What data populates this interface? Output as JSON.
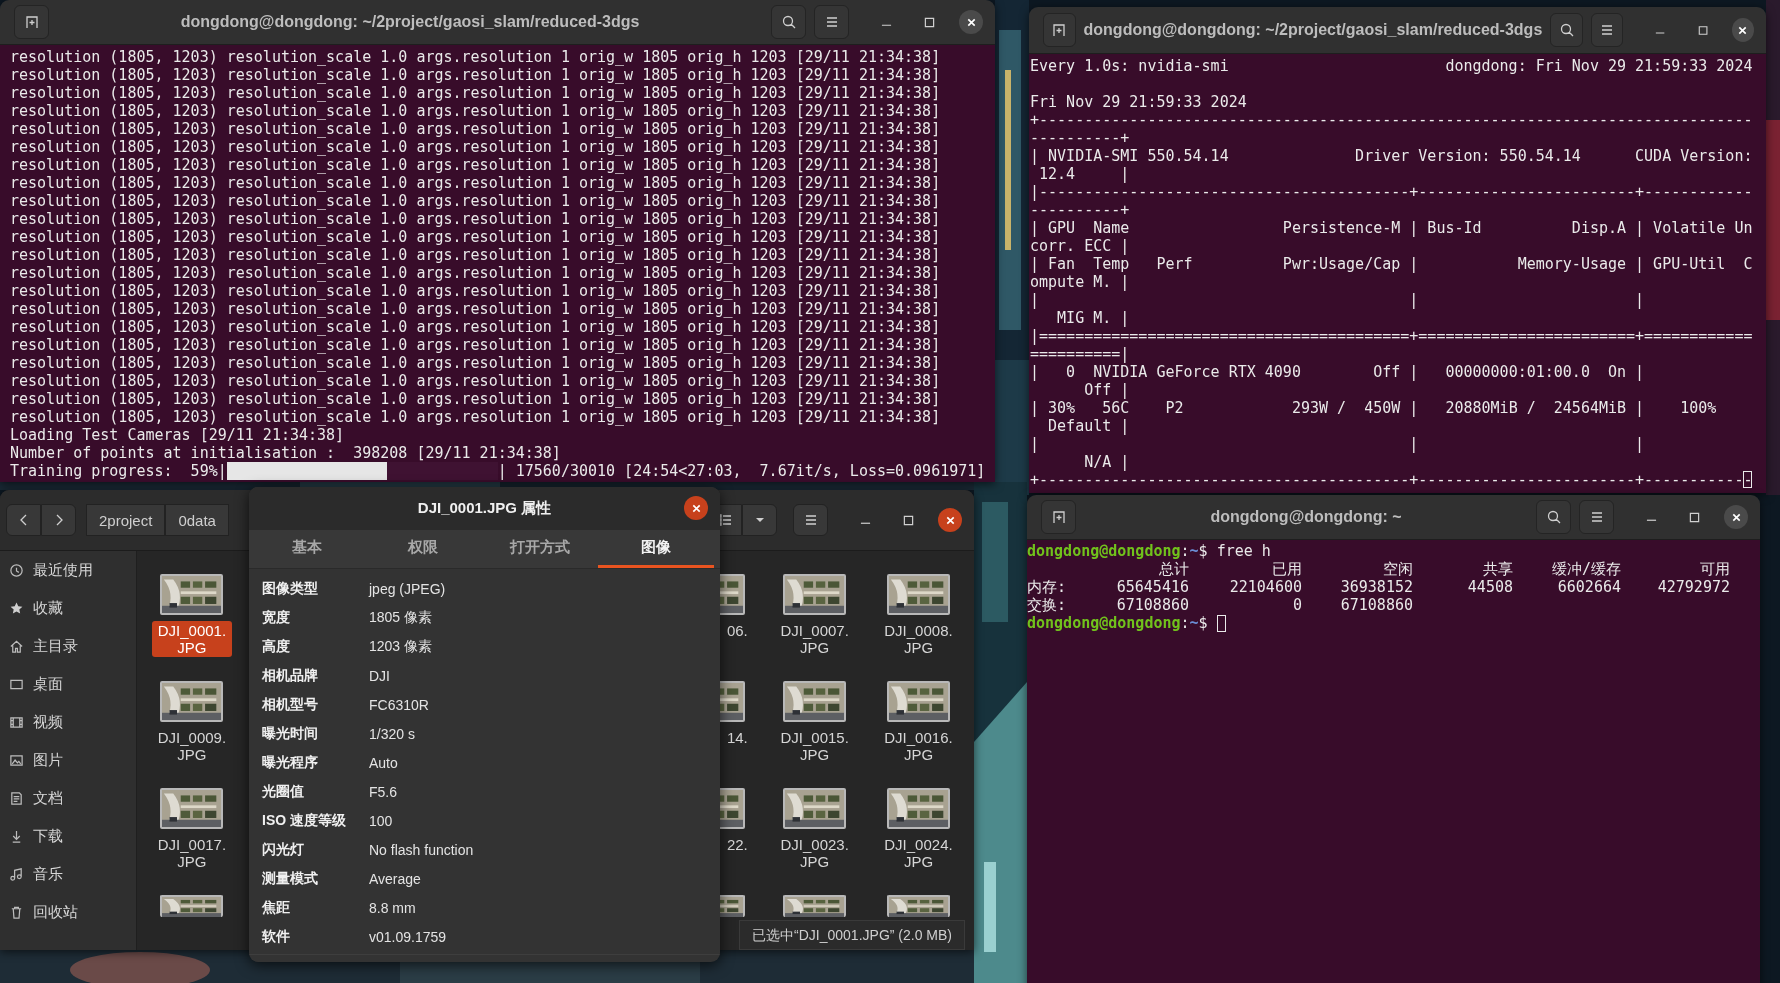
{
  "terminal_training": {
    "title": "dongdong@dongdong: ~/2project/gaosi_slam/reduced-3dgs",
    "lines": [
      "resolution (1805, 1203) resolution_scale 1.0 args.resolution 1 orig_w 1805 orig_h 1203 [29/11 21:34:38]",
      "resolution (1805, 1203) resolution_scale 1.0 args.resolution 1 orig_w 1805 orig_h 1203 [29/11 21:34:38]",
      "resolution (1805, 1203) resolution_scale 1.0 args.resolution 1 orig_w 1805 orig_h 1203 [29/11 21:34:38]",
      "resolution (1805, 1203) resolution_scale 1.0 args.resolution 1 orig_w 1805 orig_h 1203 [29/11 21:34:38]",
      "resolution (1805, 1203) resolution_scale 1.0 args.resolution 1 orig_w 1805 orig_h 1203 [29/11 21:34:38]",
      "resolution (1805, 1203) resolution_scale 1.0 args.resolution 1 orig_w 1805 orig_h 1203 [29/11 21:34:38]",
      "resolution (1805, 1203) resolution_scale 1.0 args.resolution 1 orig_w 1805 orig_h 1203 [29/11 21:34:38]",
      "resolution (1805, 1203) resolution_scale 1.0 args.resolution 1 orig_w 1805 orig_h 1203 [29/11 21:34:38]",
      "resolution (1805, 1203) resolution_scale 1.0 args.resolution 1 orig_w 1805 orig_h 1203 [29/11 21:34:38]",
      "resolution (1805, 1203) resolution_scale 1.0 args.resolution 1 orig_w 1805 orig_h 1203 [29/11 21:34:38]",
      "resolution (1805, 1203) resolution_scale 1.0 args.resolution 1 orig_w 1805 orig_h 1203 [29/11 21:34:38]",
      "resolution (1805, 1203) resolution_scale 1.0 args.resolution 1 orig_w 1805 orig_h 1203 [29/11 21:34:38]",
      "resolution (1805, 1203) resolution_scale 1.0 args.resolution 1 orig_w 1805 orig_h 1203 [29/11 21:34:38]",
      "resolution (1805, 1203) resolution_scale 1.0 args.resolution 1 orig_w 1805 orig_h 1203 [29/11 21:34:38]",
      "resolution (1805, 1203) resolution_scale 1.0 args.resolution 1 orig_w 1805 orig_h 1203 [29/11 21:34:38]",
      "resolution (1805, 1203) resolution_scale 1.0 args.resolution 1 orig_w 1805 orig_h 1203 [29/11 21:34:38]",
      "resolution (1805, 1203) resolution_scale 1.0 args.resolution 1 orig_w 1805 orig_h 1203 [29/11 21:34:38]",
      "resolution (1805, 1203) resolution_scale 1.0 args.resolution 1 orig_w 1805 orig_h 1203 [29/11 21:34:38]",
      "resolution (1805, 1203) resolution_scale 1.0 args.resolution 1 orig_w 1805 orig_h 1203 [29/11 21:34:38]",
      "resolution (1805, 1203) resolution_scale 1.0 args.resolution 1 orig_w 1805 orig_h 1203 [29/11 21:34:38]",
      "resolution (1805, 1203) resolution_scale 1.0 args.resolution 1 orig_w 1805 orig_h 1203 [29/11 21:34:38]",
      "Loading Test Cameras [29/11 21:34:38]",
      "Number of points at initialisation :  398208 [29/11 21:34:38]"
    ],
    "progress": {
      "label": "Training progress:  59%|",
      "level": 0.59,
      "stats": "| 17560/30010 [24:54<27:03,  7.67it/s, Loss=0.0961971]"
    }
  },
  "terminal_gpu": {
    "title": "dongdong@dongdong: ~/2project/gaosi_slam/reduced-3dgs",
    "header_left": "Every 1.0s: nvidia-smi",
    "header_right": "dongdong: Fri Nov 29 21:59:33 2024",
    "lines": [
      "Fri Nov 29 21:59:33 2024",
      "+-------------------------------------------------------------------------------",
      "----------+",
      "| NVIDIA-SMI 550.54.14              Driver Version: 550.54.14      CUDA Version:",
      " 12.4     |",
      "|-----------------------------------------+------------------------+------------",
      "----------+",
      "| GPU  Name                 Persistence-M | Bus-Id          Disp.A | Volatile Un",
      "corr. ECC |",
      "| Fan  Temp   Perf          Pwr:Usage/Cap |           Memory-Usage | GPU-Util  C",
      "ompute M. |",
      "|                                         |                        |",
      "   MIG M. |",
      "|=========================================+========================+============",
      "==========|",
      "|   0  NVIDIA GeForce RTX 4090        Off |   00000000:01:00.0  On |",
      "      Off |",
      "| 30%   56C    P2            293W /  450W |   20880MiB /  24564MiB |    100%",
      "  Default |",
      "|                                         |                        |",
      "      N/A |",
      "+-----------------------------------------+------------------------+------------"
    ]
  },
  "file_manager": {
    "path": [
      "2project",
      "0data"
    ],
    "sidebar": [
      "最近使用",
      "收藏",
      "主目录",
      "桌面",
      "视频",
      "图片",
      "文档",
      "下载",
      "音乐",
      "回收站"
    ],
    "files": [
      [
        {
          "label": "DJI_0001.\nJPG",
          "selected": true
        },
        {
          "label": "06.",
          "selected": false
        },
        {
          "label": "DJI_0007.\nJPG",
          "selected": false
        },
        {
          "label": "DJI_0008.\nJPG",
          "selected": false
        }
      ],
      [
        {
          "label": "DJI_0009.\nJPG",
          "selected": false
        },
        {
          "label": "14.",
          "selected": false
        },
        {
          "label": "DJI_0015.\nJPG",
          "selected": false
        },
        {
          "label": "DJI_0016.\nJPG",
          "selected": false
        }
      ],
      [
        {
          "label": "DJI_0017.\nJPG",
          "selected": false
        },
        {
          "label": "22.",
          "selected": false
        },
        {
          "label": "DJI_0023.\nJPG",
          "selected": false
        },
        {
          "label": "DJI_0024.\nJPG",
          "selected": false
        }
      ],
      [
        {
          "selected": false
        },
        {
          "selected": false
        },
        {
          "selected": false
        },
        {
          "selected": false
        }
      ]
    ],
    "status": "已选中“DJI_0001.JPG” (2.0 MB)"
  },
  "properties_dialog": {
    "title": "DJI_0001.JPG 属性",
    "tabs": [
      {
        "label": "基本",
        "selected": false
      },
      {
        "label": "权限",
        "selected": false
      },
      {
        "label": "打开方式",
        "selected": false
      },
      {
        "label": "图像",
        "selected": true
      }
    ],
    "rows": [
      {
        "label": "图像类型",
        "value": "jpeg (JPEG)"
      },
      {
        "label": "宽度",
        "value": "1805 像素"
      },
      {
        "label": "高度",
        "value": "1203 像素"
      },
      {
        "label": "相机品牌",
        "value": "DJI"
      },
      {
        "label": "相机型号",
        "value": "FC6310R"
      },
      {
        "label": "曝光时间",
        "value": "1/320 s"
      },
      {
        "label": "曝光程序",
        "value": "Auto"
      },
      {
        "label": "光圈值",
        "value": "F5.6"
      },
      {
        "label": "ISO 速度等级",
        "value": "100"
      },
      {
        "label": "闪光灯",
        "value": "No flash function"
      },
      {
        "label": "测量模式",
        "value": "Average"
      },
      {
        "label": "焦距",
        "value": "8.8 mm"
      },
      {
        "label": "软件",
        "value": "v01.09.1759"
      }
    ]
  },
  "terminal_memory": {
    "title": "dongdong@dongdong: ~",
    "prompt": {
      "user": "dongdong@dongdong",
      "sep": ":",
      "path": "~",
      "symbol": "$"
    },
    "command": " free h",
    "prompt2": {
      "user": "dongdong@dongdong",
      "sep": ":",
      "path": "~",
      "symbol": "$"
    },
    "columns": [
      "总计",
      "已用",
      "空闲",
      "共享",
      "缓冲/缓存",
      "可用"
    ],
    "rows": [
      {
        "label": "内存:",
        "values": [
          "65645416",
          "22104600",
          "36938152",
          "44508",
          "6602664",
          "42792972"
        ]
      },
      {
        "label": "交换:",
        "values": [
          "67108860",
          "0",
          "67108860"
        ]
      }
    ]
  }
}
